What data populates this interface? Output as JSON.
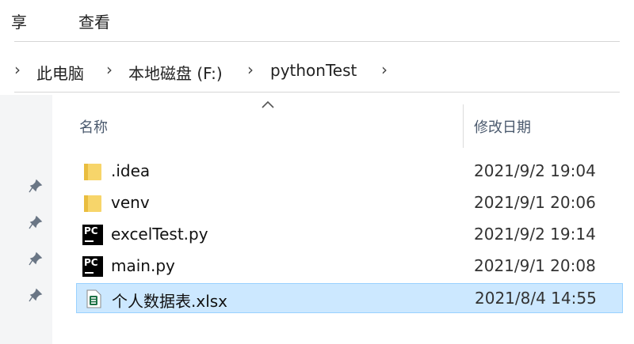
{
  "ribbon": {
    "tabs": [
      "享",
      "查看"
    ]
  },
  "breadcrumb": [
    "此电脑",
    "本地磁盘 (F:)",
    "pythonTest"
  ],
  "columns": {
    "name": "名称",
    "date_modified": "修改日期"
  },
  "files": [
    {
      "name": ".idea",
      "date": "2021/9/2 19:04",
      "icon": "folder-icon"
    },
    {
      "name": "venv",
      "date": "2021/9/1 20:06",
      "icon": "folder-icon"
    },
    {
      "name": "excelTest.py",
      "date": "2021/9/2 19:14",
      "icon": "pycharm-file-icon"
    },
    {
      "name": "main.py",
      "date": "2021/9/1 20:08",
      "icon": "pycharm-file-icon"
    },
    {
      "name": "个人数据表.xlsx",
      "date": "2021/8/4 14:55",
      "icon": "excel-file-icon",
      "selected": true
    }
  ],
  "colors": {
    "selection": "#cce8ff",
    "selection_border": "#99d1ff",
    "folder": "#f7d56a",
    "excel": "#1e7145"
  },
  "pin_icon": "pin-icon",
  "sort_icon": "sort-ascending-icon"
}
